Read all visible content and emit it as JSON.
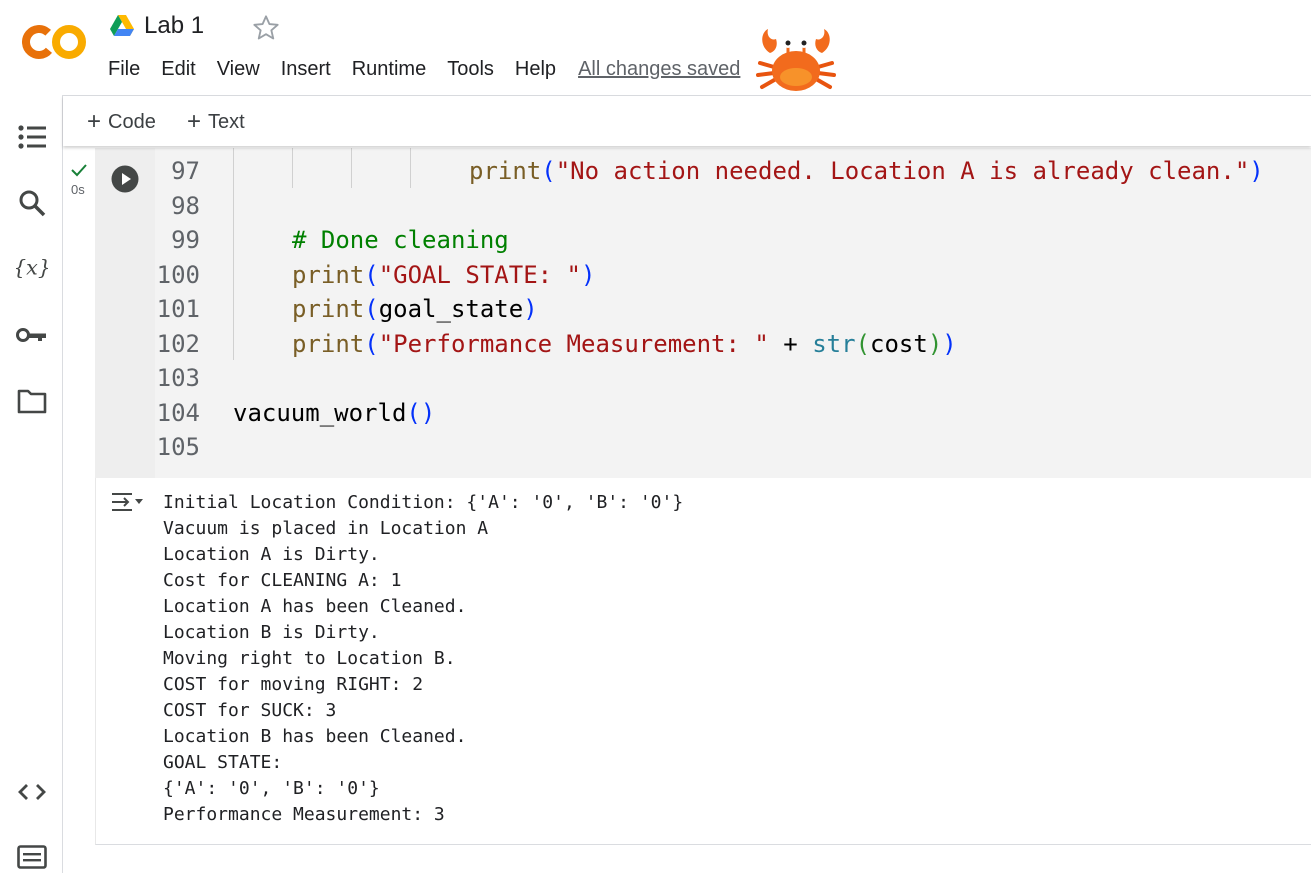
{
  "app": {
    "title": "Lab 1",
    "save_status": "All changes saved"
  },
  "menu": [
    "File",
    "Edit",
    "View",
    "Insert",
    "Runtime",
    "Tools",
    "Help"
  ],
  "toolbar": {
    "add_code": "Code",
    "add_text": "Text"
  },
  "cell": {
    "status": "success",
    "exec_time": "0s",
    "lines": [
      {
        "num": "97",
        "indent": 4,
        "tokens": [
          {
            "t": "print",
            "c": "kw-fn"
          },
          {
            "t": "(",
            "c": "br1"
          },
          {
            "t": "\"No action needed. Location A is already clean.\"",
            "c": "str"
          },
          {
            "t": ")",
            "c": "br1"
          }
        ]
      },
      {
        "num": "98",
        "indent": 0,
        "tokens": []
      },
      {
        "num": "99",
        "indent": 1,
        "tokens": [
          {
            "t": "# Done cleaning",
            "c": "cmt"
          }
        ]
      },
      {
        "num": "100",
        "indent": 1,
        "tokens": [
          {
            "t": "print",
            "c": "kw-fn"
          },
          {
            "t": "(",
            "c": "br1"
          },
          {
            "t": "\"GOAL STATE: \"",
            "c": "str"
          },
          {
            "t": ")",
            "c": "br1"
          }
        ]
      },
      {
        "num": "101",
        "indent": 1,
        "tokens": [
          {
            "t": "print",
            "c": "kw-fn"
          },
          {
            "t": "(",
            "c": "br1"
          },
          {
            "t": "goal_state",
            "c": ""
          },
          {
            "t": ")",
            "c": "br1"
          }
        ]
      },
      {
        "num": "102",
        "indent": 1,
        "tokens": [
          {
            "t": "print",
            "c": "kw-fn"
          },
          {
            "t": "(",
            "c": "br1"
          },
          {
            "t": "\"Performance Measurement: \"",
            "c": "str"
          },
          {
            "t": " + ",
            "c": ""
          },
          {
            "t": "str",
            "c": "bi"
          },
          {
            "t": "(",
            "c": "br2"
          },
          {
            "t": "cost",
            "c": ""
          },
          {
            "t": ")",
            "c": "br2"
          },
          {
            "t": ")",
            "c": "br1"
          }
        ]
      },
      {
        "num": "103",
        "indent": 0,
        "tokens": []
      },
      {
        "num": "104",
        "indent": 0,
        "tokens": [
          {
            "t": "vacuum_world",
            "c": ""
          },
          {
            "t": "()",
            "c": "br1"
          }
        ]
      },
      {
        "num": "105",
        "indent": 0,
        "tokens": []
      }
    ]
  },
  "output": {
    "lines": [
      "Initial Location Condition: {'A': '0', 'B': '0'}",
      "Vacuum is placed in Location A",
      "Location A is Dirty.",
      "Cost for CLEANING A: 1",
      "Location A has been Cleaned.",
      "Location B is Dirty.",
      "Moving right to Location B.",
      "COST for moving RIGHT: 2",
      "COST for SUCK: 3",
      "Location B has been Cleaned.",
      "GOAL STATE:",
      "{'A': '0', 'B': '0'}",
      "Performance Measurement: 3"
    ]
  },
  "rail_icons": [
    "table-of-contents-icon",
    "search-icon",
    "variables-icon",
    "secrets-key-icon",
    "files-folder-icon",
    "code-snippets-icon",
    "command-palette-icon"
  ],
  "colors": {
    "logo_orange": "#f9ab00",
    "logo_dark_orange": "#e8710a",
    "string": "#a31515",
    "comment": "#008000",
    "function": "#795e26",
    "bracket": "#0431fa",
    "builtin": "#267f99",
    "success_check": "#188038"
  }
}
